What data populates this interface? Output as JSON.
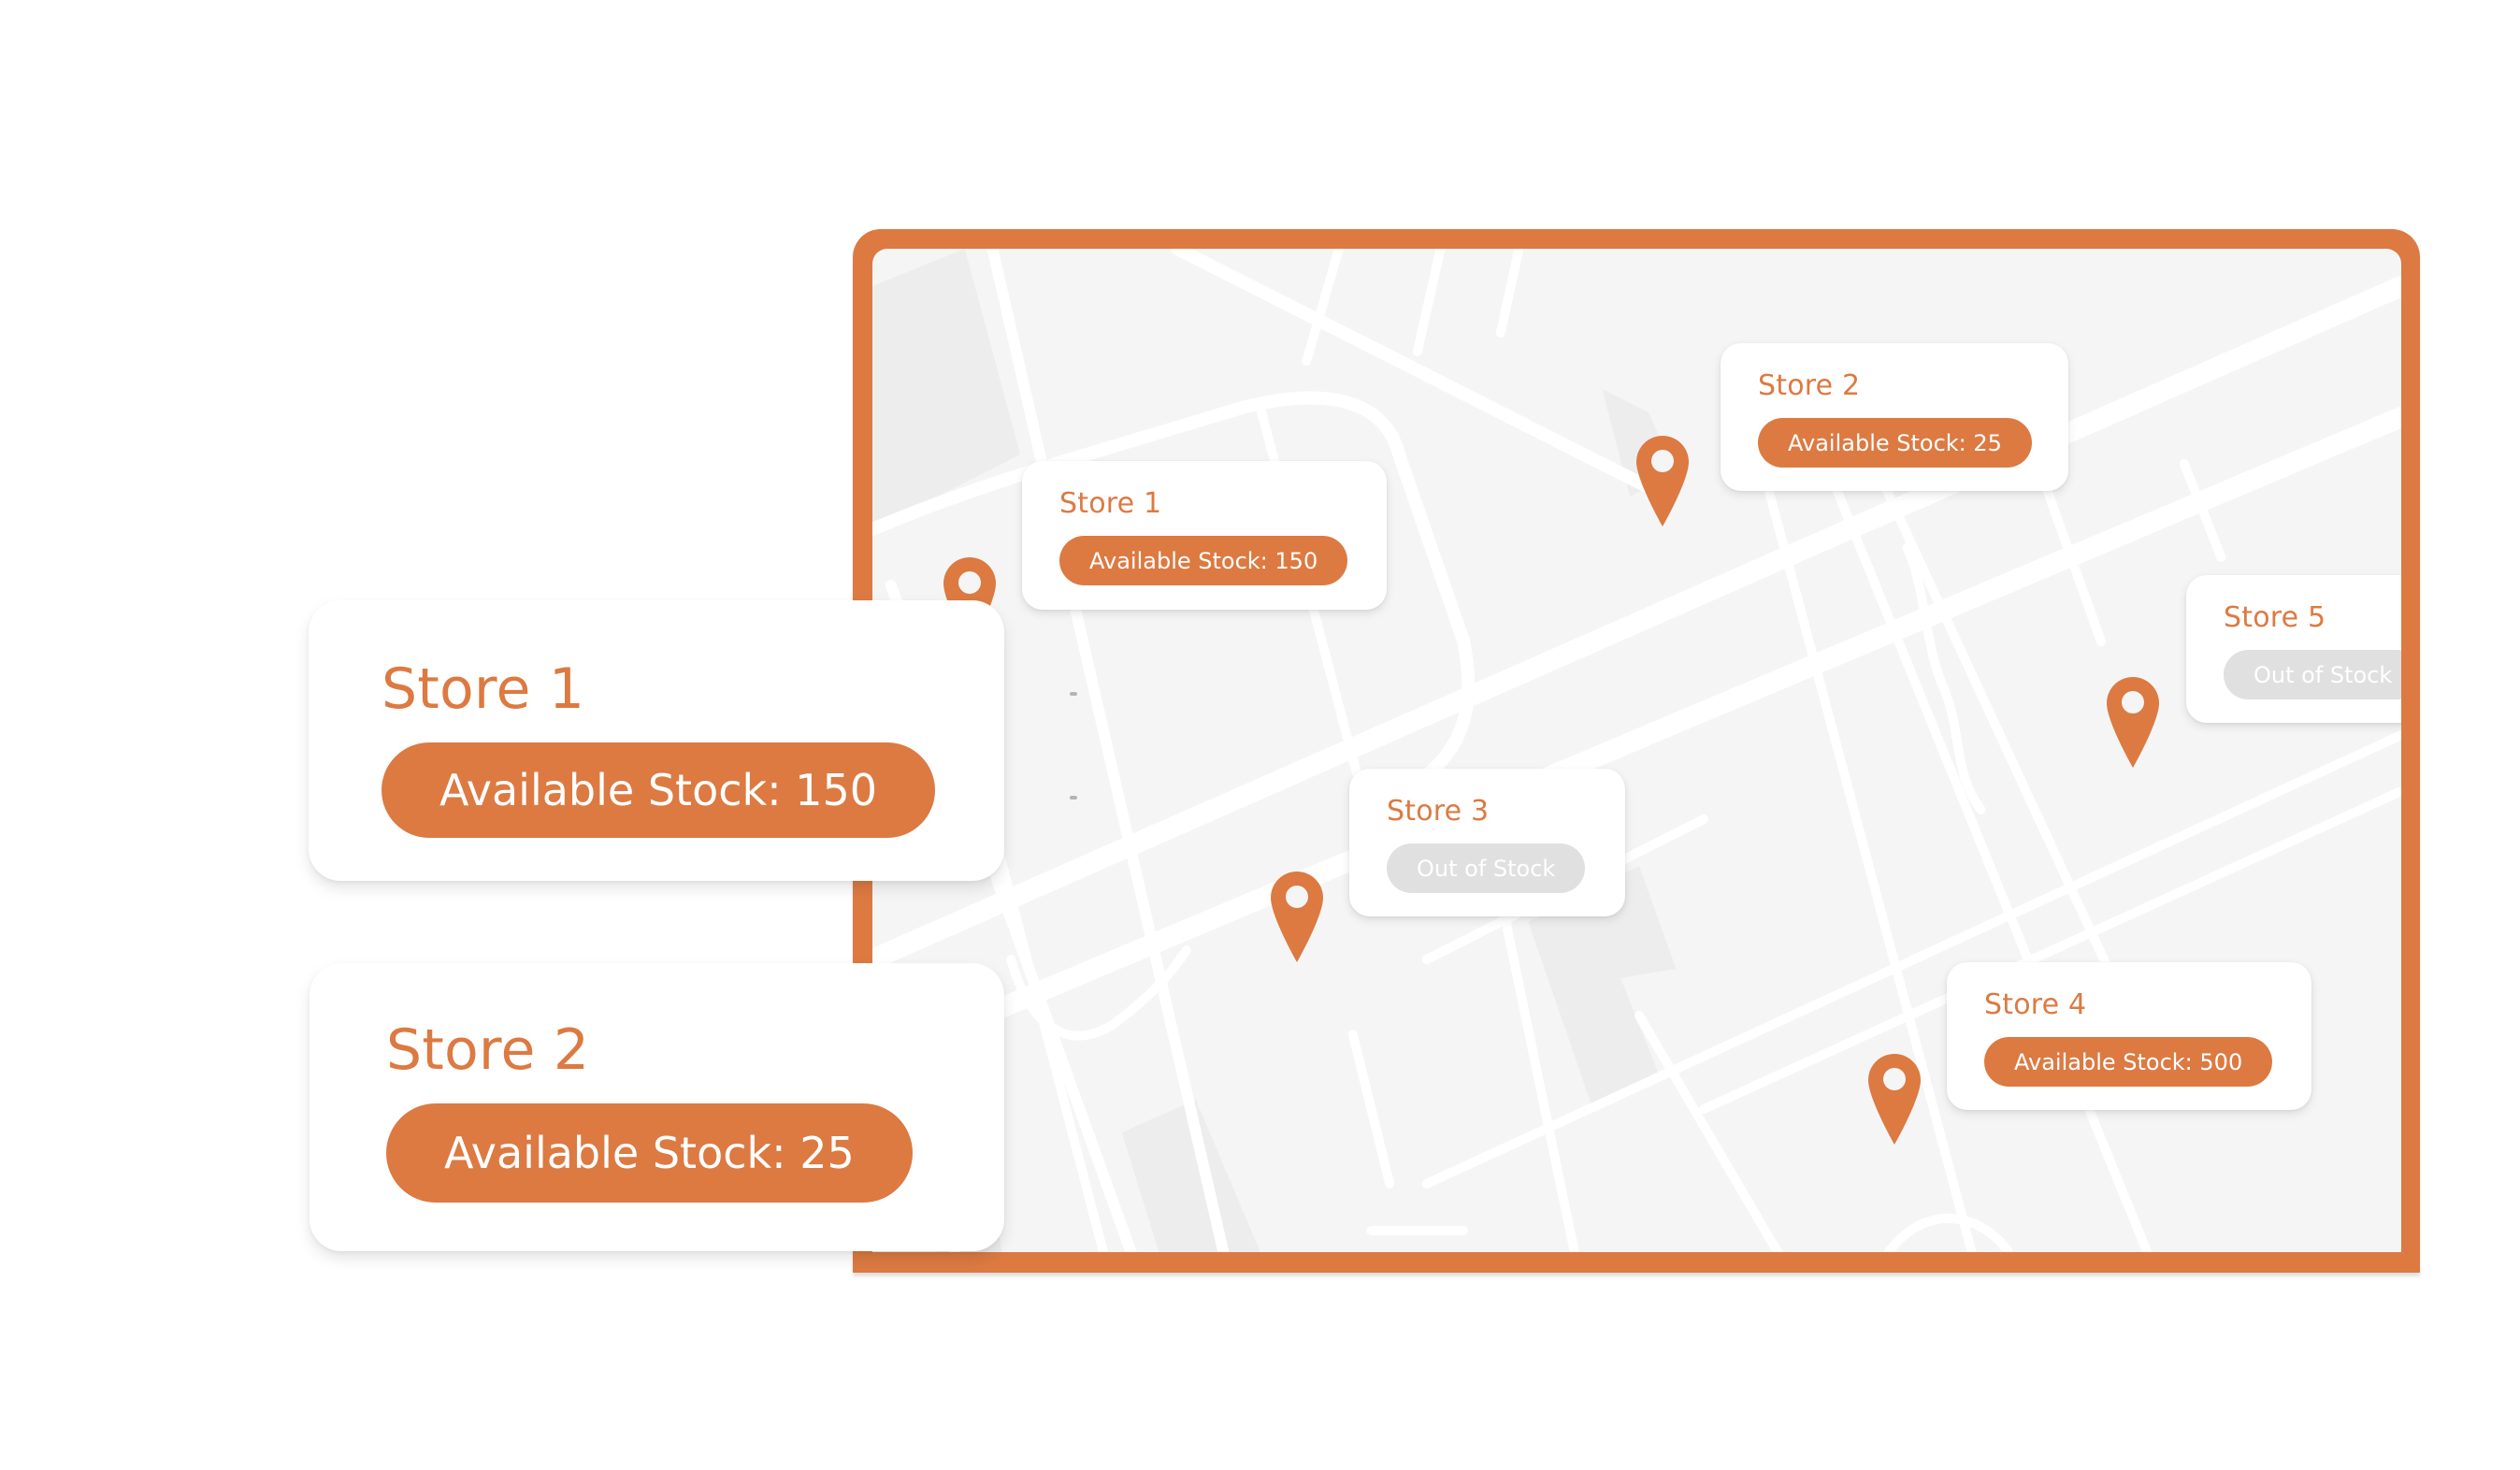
{
  "theme": {
    "accent": "#DC7A42",
    "map_background": "#F5F5F5",
    "road": "#FFFFFF",
    "block": "#EDEDED",
    "out_of_stock_badge": "#E0E0E0"
  },
  "map": {
    "pins": [
      {
        "store": "Store 1",
        "icon": "map-pin-icon"
      },
      {
        "store": "Store 2",
        "icon": "map-pin-icon"
      },
      {
        "store": "Store 3",
        "icon": "map-pin-icon"
      },
      {
        "store": "Store 4",
        "icon": "map-pin-icon"
      },
      {
        "store": "Store 5",
        "icon": "map-pin-icon"
      }
    ],
    "cards": [
      {
        "name": "Store 1",
        "status": "in_stock",
        "stock": 150,
        "label": "Available Stock: 150"
      },
      {
        "name": "Store 2",
        "status": "in_stock",
        "stock": 25,
        "label": "Available Stock: 25"
      },
      {
        "name": "Store 3",
        "status": "out_of_stock",
        "stock": 0,
        "label": "Out of Stock"
      },
      {
        "name": "Store 4",
        "status": "in_stock",
        "stock": 500,
        "label": "Available Stock: 500"
      },
      {
        "name": "Store 5",
        "status": "out_of_stock",
        "stock": 0,
        "label": "Out of Stock"
      }
    ]
  },
  "featured_cards": [
    {
      "name": "Store 1",
      "stock": 150,
      "label": "Available Stock: 150"
    },
    {
      "name": "Store 2",
      "stock": 25,
      "label": "Available Stock: 25"
    }
  ]
}
